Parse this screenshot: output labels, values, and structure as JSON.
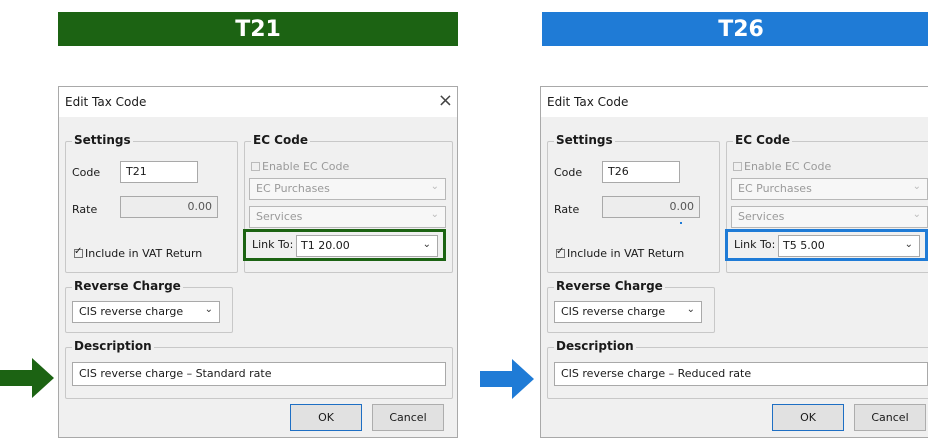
{
  "colors": {
    "green": "#1c6313",
    "blue": "#1f7bd6"
  },
  "banners": {
    "left": "T21",
    "right": "T26"
  },
  "dialogs": [
    {
      "title": "Edit Tax Code",
      "close_icon": "×",
      "settings": {
        "group_label": "Settings",
        "code_label": "Code",
        "code_value": "T21",
        "rate_label": "Rate",
        "rate_value": "0.00",
        "vat_label": "Include in VAT Return",
        "vat_checked": true
      },
      "ec_code": {
        "group_label": "EC Code",
        "enable_label": "Enable EC Code",
        "purchases": "EC Purchases",
        "services": "Services",
        "link_label": "Link To:",
        "link_value": "T1 20.00",
        "highlight_color": "#1c6313"
      },
      "reverse_charge": {
        "group_label": "Reverse Charge",
        "value": "CIS reverse charge"
      },
      "description": {
        "group_label": "Description",
        "value": "CIS reverse charge – Standard rate"
      },
      "buttons": {
        "ok": "OK",
        "cancel": "Cancel"
      }
    },
    {
      "title": "Edit Tax Code",
      "close_icon": "×",
      "settings": {
        "group_label": "Settings",
        "code_label": "Code",
        "code_value": "T26",
        "rate_label": "Rate",
        "rate_value": "0.00",
        "vat_label": "Include in VAT Return",
        "vat_checked": true
      },
      "ec_code": {
        "group_label": "EC Code",
        "enable_label": "Enable EC Code",
        "purchases": "EC Purchases",
        "services": "Services",
        "link_label": "Link To:",
        "link_value": "T5 5.00",
        "highlight_color": "#1f7bd6"
      },
      "reverse_charge": {
        "group_label": "Reverse Charge",
        "value": "CIS reverse charge"
      },
      "description": {
        "group_label": "Description",
        "value": "CIS reverse charge – Reduced rate"
      },
      "buttons": {
        "ok": "OK",
        "cancel": "Cancel"
      }
    }
  ]
}
